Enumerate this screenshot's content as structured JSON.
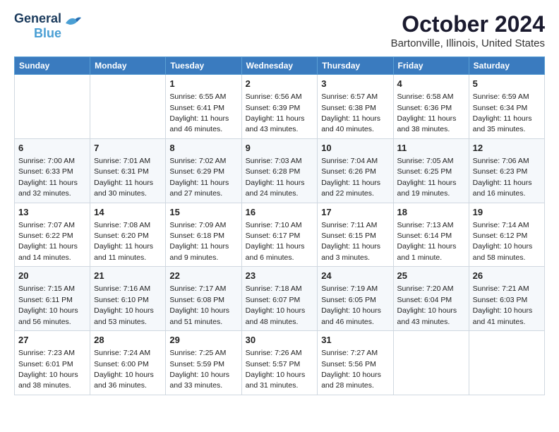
{
  "logo": {
    "line1": "General",
    "line2": "Blue"
  },
  "title": "October 2024",
  "subtitle": "Bartonville, Illinois, United States",
  "days_of_week": [
    "Sunday",
    "Monday",
    "Tuesday",
    "Wednesday",
    "Thursday",
    "Friday",
    "Saturday"
  ],
  "weeks": [
    [
      {
        "day": "",
        "info": ""
      },
      {
        "day": "",
        "info": ""
      },
      {
        "day": "1",
        "info": "Sunrise: 6:55 AM\nSunset: 6:41 PM\nDaylight: 11 hours and 46 minutes."
      },
      {
        "day": "2",
        "info": "Sunrise: 6:56 AM\nSunset: 6:39 PM\nDaylight: 11 hours and 43 minutes."
      },
      {
        "day": "3",
        "info": "Sunrise: 6:57 AM\nSunset: 6:38 PM\nDaylight: 11 hours and 40 minutes."
      },
      {
        "day": "4",
        "info": "Sunrise: 6:58 AM\nSunset: 6:36 PM\nDaylight: 11 hours and 38 minutes."
      },
      {
        "day": "5",
        "info": "Sunrise: 6:59 AM\nSunset: 6:34 PM\nDaylight: 11 hours and 35 minutes."
      }
    ],
    [
      {
        "day": "6",
        "info": "Sunrise: 7:00 AM\nSunset: 6:33 PM\nDaylight: 11 hours and 32 minutes."
      },
      {
        "day": "7",
        "info": "Sunrise: 7:01 AM\nSunset: 6:31 PM\nDaylight: 11 hours and 30 minutes."
      },
      {
        "day": "8",
        "info": "Sunrise: 7:02 AM\nSunset: 6:29 PM\nDaylight: 11 hours and 27 minutes."
      },
      {
        "day": "9",
        "info": "Sunrise: 7:03 AM\nSunset: 6:28 PM\nDaylight: 11 hours and 24 minutes."
      },
      {
        "day": "10",
        "info": "Sunrise: 7:04 AM\nSunset: 6:26 PM\nDaylight: 11 hours and 22 minutes."
      },
      {
        "day": "11",
        "info": "Sunrise: 7:05 AM\nSunset: 6:25 PM\nDaylight: 11 hours and 19 minutes."
      },
      {
        "day": "12",
        "info": "Sunrise: 7:06 AM\nSunset: 6:23 PM\nDaylight: 11 hours and 16 minutes."
      }
    ],
    [
      {
        "day": "13",
        "info": "Sunrise: 7:07 AM\nSunset: 6:22 PM\nDaylight: 11 hours and 14 minutes."
      },
      {
        "day": "14",
        "info": "Sunrise: 7:08 AM\nSunset: 6:20 PM\nDaylight: 11 hours and 11 minutes."
      },
      {
        "day": "15",
        "info": "Sunrise: 7:09 AM\nSunset: 6:18 PM\nDaylight: 11 hours and 9 minutes."
      },
      {
        "day": "16",
        "info": "Sunrise: 7:10 AM\nSunset: 6:17 PM\nDaylight: 11 hours and 6 minutes."
      },
      {
        "day": "17",
        "info": "Sunrise: 7:11 AM\nSunset: 6:15 PM\nDaylight: 11 hours and 3 minutes."
      },
      {
        "day": "18",
        "info": "Sunrise: 7:13 AM\nSunset: 6:14 PM\nDaylight: 11 hours and 1 minute."
      },
      {
        "day": "19",
        "info": "Sunrise: 7:14 AM\nSunset: 6:12 PM\nDaylight: 10 hours and 58 minutes."
      }
    ],
    [
      {
        "day": "20",
        "info": "Sunrise: 7:15 AM\nSunset: 6:11 PM\nDaylight: 10 hours and 56 minutes."
      },
      {
        "day": "21",
        "info": "Sunrise: 7:16 AM\nSunset: 6:10 PM\nDaylight: 10 hours and 53 minutes."
      },
      {
        "day": "22",
        "info": "Sunrise: 7:17 AM\nSunset: 6:08 PM\nDaylight: 10 hours and 51 minutes."
      },
      {
        "day": "23",
        "info": "Sunrise: 7:18 AM\nSunset: 6:07 PM\nDaylight: 10 hours and 48 minutes."
      },
      {
        "day": "24",
        "info": "Sunrise: 7:19 AM\nSunset: 6:05 PM\nDaylight: 10 hours and 46 minutes."
      },
      {
        "day": "25",
        "info": "Sunrise: 7:20 AM\nSunset: 6:04 PM\nDaylight: 10 hours and 43 minutes."
      },
      {
        "day": "26",
        "info": "Sunrise: 7:21 AM\nSunset: 6:03 PM\nDaylight: 10 hours and 41 minutes."
      }
    ],
    [
      {
        "day": "27",
        "info": "Sunrise: 7:23 AM\nSunset: 6:01 PM\nDaylight: 10 hours and 38 minutes."
      },
      {
        "day": "28",
        "info": "Sunrise: 7:24 AM\nSunset: 6:00 PM\nDaylight: 10 hours and 36 minutes."
      },
      {
        "day": "29",
        "info": "Sunrise: 7:25 AM\nSunset: 5:59 PM\nDaylight: 10 hours and 33 minutes."
      },
      {
        "day": "30",
        "info": "Sunrise: 7:26 AM\nSunset: 5:57 PM\nDaylight: 10 hours and 31 minutes."
      },
      {
        "day": "31",
        "info": "Sunrise: 7:27 AM\nSunset: 5:56 PM\nDaylight: 10 hours and 28 minutes."
      },
      {
        "day": "",
        "info": ""
      },
      {
        "day": "",
        "info": ""
      }
    ]
  ]
}
